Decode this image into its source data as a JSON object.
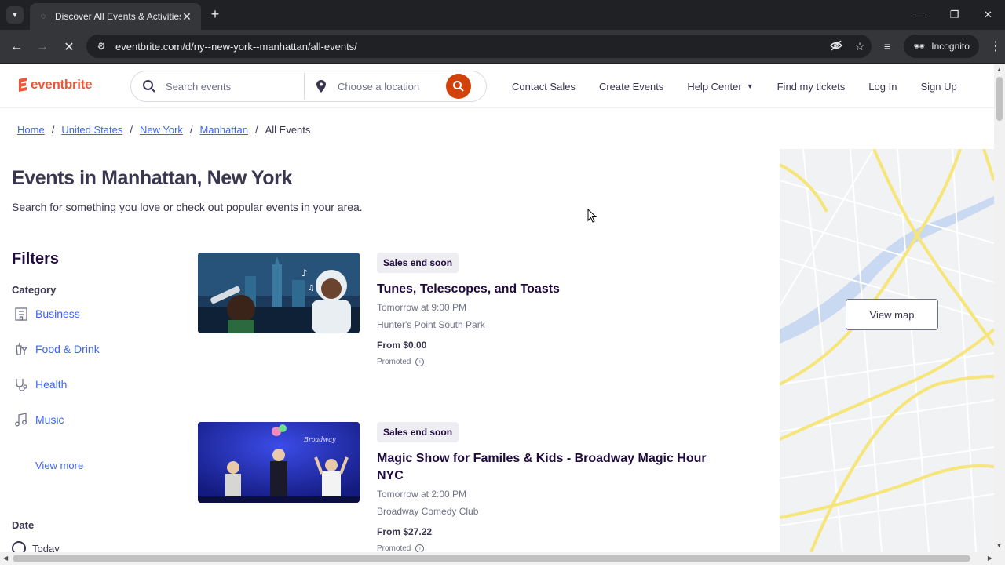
{
  "browser": {
    "tab_title": "Discover All Events & Activities",
    "url": "eventbrite.com/d/ny--new-york--manhattan/all-events/",
    "profile_label": "Incognito"
  },
  "header": {
    "logo_text": "eventbrite",
    "search_placeholder": "Search events",
    "location_placeholder": "Choose a location",
    "nav": {
      "contact_sales": "Contact Sales",
      "create_events": "Create Events",
      "help_center": "Help Center",
      "find_tickets": "Find my tickets",
      "log_in": "Log In",
      "sign_up": "Sign Up"
    }
  },
  "breadcrumb": {
    "items": [
      "Home",
      "United States",
      "New York",
      "Manhattan"
    ],
    "separator": "/",
    "current": "All Events"
  },
  "page": {
    "title": "Events in Manhattan, New York",
    "subtitle": "Search for something you love or check out popular events in your area."
  },
  "filters": {
    "title": "Filters",
    "category_label": "Category",
    "categories": [
      {
        "label": "Business",
        "icon": "building-icon"
      },
      {
        "label": "Food & Drink",
        "icon": "food-drink-icon"
      },
      {
        "label": "Health",
        "icon": "stethoscope-icon"
      },
      {
        "label": "Music",
        "icon": "music-note-icon"
      }
    ],
    "view_more": "View more",
    "date_label": "Date",
    "date_options": [
      "Today"
    ]
  },
  "events": [
    {
      "badge": "Sales end soon",
      "title": "Tunes, Telescopes, and Toasts",
      "date": "Tomorrow at 9:00 PM",
      "venue": "Hunter's Point South Park",
      "price": "From $0.00",
      "promoted": "Promoted"
    },
    {
      "badge": "Sales end soon",
      "title": "Magic Show for Familes & Kids - Broadway Magic Hour NYC",
      "date": "Tomorrow at 2:00 PM",
      "venue": "Broadway Comedy Club",
      "price": "From $27.22",
      "promoted": "Promoted"
    }
  ],
  "map": {
    "button_label": "View map"
  },
  "colors": {
    "brand": "#f05537",
    "search_button": "#d1410c",
    "link": "#3d64ff",
    "text_dark": "#39364f"
  }
}
